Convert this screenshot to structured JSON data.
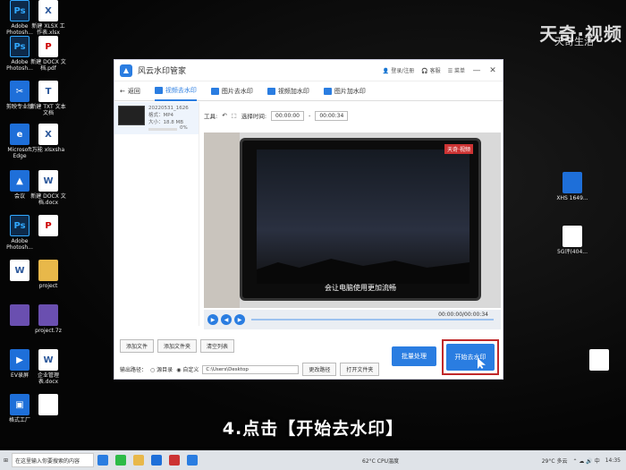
{
  "watermark": {
    "top": "天奇·视频",
    "sub": "天奇生活"
  },
  "desktop_icons": [
    {
      "label": "Adobe Photosh...",
      "glyph": "Ps",
      "kind": "ps"
    },
    {
      "label": "新建 XLSX 工作表.xlsx",
      "glyph": "X",
      "kind": "doc"
    },
    {
      "label": "Adobe Photosh...",
      "glyph": "Ps",
      "kind": "ps"
    },
    {
      "label": "新建 DOCX 文档.pdf",
      "glyph": "P",
      "kind": "pdf"
    },
    {
      "label": "剪映专业版",
      "glyph": "✂",
      "kind": "blue"
    },
    {
      "label": "新建 TXT 文本文档",
      "glyph": "T",
      "kind": "doc"
    },
    {
      "label": "Microsoft Edge",
      "glyph": "e",
      "kind": "blue"
    },
    {
      "label": "万能 xlsxsha",
      "glyph": "X",
      "kind": "doc"
    },
    {
      "label": "会议",
      "glyph": "▲",
      "kind": "blue"
    },
    {
      "label": "新建 DOCX 文档.docx",
      "glyph": "W",
      "kind": "doc"
    },
    {
      "label": "Adobe Photosh...",
      "glyph": "Ps",
      "kind": "ps"
    },
    {
      "label": "",
      "glyph": "P",
      "kind": "pdf"
    },
    {
      "label": "",
      "glyph": "W",
      "kind": "doc"
    },
    {
      "label": "project",
      "glyph": "",
      "kind": "folder"
    },
    {
      "label": "",
      "glyph": "",
      "kind": "zip"
    },
    {
      "label": "project.7z",
      "glyph": "",
      "kind": "zip"
    },
    {
      "label": "EV录屏",
      "glyph": "▶",
      "kind": "blue"
    },
    {
      "label": "企业管理表.docx",
      "glyph": "W",
      "kind": "doc"
    },
    {
      "label": "格式工厂",
      "glyph": "▣",
      "kind": "blue"
    },
    {
      "label": "",
      "glyph": "",
      "kind": "doc"
    }
  ],
  "right_icons": [
    {
      "label": "XHS 1649..."
    },
    {
      "label": "5G评(404..."
    }
  ],
  "app": {
    "title": "风云水印管家",
    "login": "登录/注册",
    "service": "客服",
    "extra": "菜单",
    "back": "返回",
    "tabs": [
      "视频去水印",
      "图片去水印",
      "视频加水印",
      "图片加水印"
    ],
    "file": {
      "name": "20220531_1626",
      "meta1": "格式：MP4",
      "meta2": "大小：18.8 MB",
      "progress": "0%"
    },
    "toolbar": {
      "label": "工具:",
      "range_label": "选择时间:",
      "start": "00:00:00",
      "end": "00:00:34"
    },
    "video_badge": "天奇·视频",
    "subtitle": "会让电脑使用更加流畅",
    "time": "00:00:00/00:00:34",
    "buttons": {
      "add_file": "添加文件",
      "add_folder": "添加文件夹",
      "clear": "清空列表"
    },
    "output": {
      "label": "输出路径：",
      "opt1": "源目录",
      "opt2": "自定义",
      "path": "C:\\Users\\Desktop",
      "browse": "更改路径",
      "open": "打开文件夹"
    },
    "batch": "批量处理",
    "start": "开始去水印"
  },
  "caption": "4.点击【开始去水印】",
  "taskbar": {
    "search": "在这里输入你要搜索的内容",
    "temp": "29°C 多云",
    "cpu": "62°C CPU温度",
    "time": "14:35",
    "date": "2022/6/1"
  }
}
